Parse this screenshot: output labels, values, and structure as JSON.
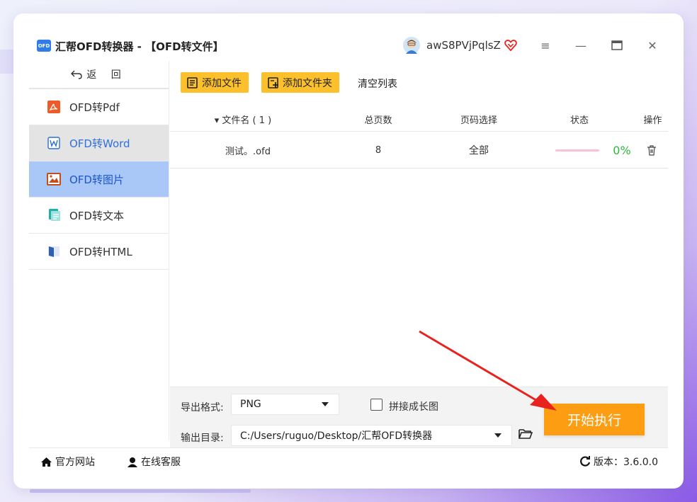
{
  "app": {
    "logo_text": "OFD",
    "title": "汇帮OFD转换器 - 【OFD转文件】",
    "username": "awS8PVjPqlsZ"
  },
  "window_controls": {
    "menu": "≡",
    "minimize": "—",
    "maximize": "▭",
    "close": "✕"
  },
  "sidebar": {
    "back_label": "返 回",
    "items": [
      {
        "label": "OFD转Pdf",
        "icon": "pdf-icon",
        "color": "#f05a28"
      },
      {
        "label": "OFD转Word",
        "icon": "word-icon",
        "color": "#2b6fd6"
      },
      {
        "label": "OFD转图片",
        "icon": "image-icon",
        "color": "#c44d1b"
      },
      {
        "label": "OFD转文本",
        "icon": "text-icon",
        "color": "#20b2aa"
      },
      {
        "label": "OFD转HTML",
        "icon": "html-icon",
        "color": "#2f5fb0"
      }
    ],
    "active_index": 2,
    "hover_index": 1
  },
  "toolbar": {
    "add_file": "添加文件",
    "add_folder": "添加文件夹",
    "clear_list": "清空列表"
  },
  "table": {
    "headers": {
      "filename": "▾ 文件名 ( 1 )",
      "pages": "总页数",
      "page_select": "页码选择",
      "status": "状态",
      "action": "操作"
    },
    "rows": [
      {
        "filename": "测试。.ofd",
        "pages": "8",
        "page_select": "全部",
        "progress": 0,
        "progress_text": "0%"
      }
    ]
  },
  "bottom": {
    "format_label": "导出格式:",
    "format_value": "PNG",
    "merge_label": "拼接成长图",
    "merge_checked": false,
    "output_label": "输出目录:",
    "output_value": "C:/Users/ruguo/Desktop/汇帮OFD转换器",
    "start_button": "开始执行"
  },
  "statusbar": {
    "website": "官方网站",
    "support": "在线客服",
    "version": "版本：3.6.0.0"
  },
  "colors": {
    "accent_yellow": "#fcc02d",
    "start_orange": "#fd9d12",
    "active_blue": "#a9c8f7",
    "progress_green": "#2db83d",
    "annotation_red": "#e8231f"
  }
}
